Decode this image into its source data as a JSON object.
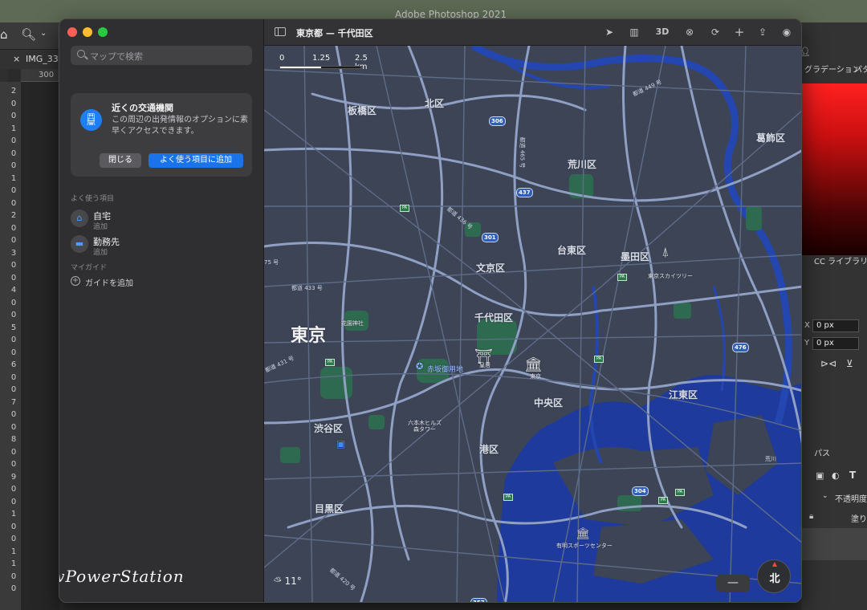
{
  "photoshop": {
    "title": "Adobe Photoshop 2021",
    "doc_tab": "IMG_33",
    "ruler_start": "300",
    "ruler_left_digits": [
      "2",
      "0",
      "0",
      "1",
      "0",
      "0",
      "0",
      "1",
      "0",
      "0",
      "2",
      "0",
      "0",
      "3",
      "0",
      "0",
      "4",
      "0",
      "0",
      "5",
      "0",
      "0",
      "6",
      "0",
      "0",
      "7",
      "0",
      "0",
      "8",
      "0",
      "0",
      "9",
      "0",
      "0",
      "1",
      "0",
      "0",
      "1",
      "1",
      "0",
      "0"
    ],
    "right_panel": {
      "gradients_tab": "グラデーション",
      "patterns_tab": "パタ",
      "libraries_label": "CC ライブラリ",
      "x_label": "X",
      "x_value": "0 px",
      "y_label": "Y",
      "y_value": "0 px",
      "paths_tab": "パス",
      "opacity_label": "不透明度",
      "fill_label": "塗り"
    }
  },
  "maps": {
    "search_placeholder": "マップで検索",
    "transit_card": {
      "title": "近くの交通機関",
      "body": "この周辺の出発情報のオプションに素早くアクセスできます。",
      "close_label": "閉じる",
      "add_label": "よく使う項目に追加"
    },
    "favorites_header": "よく使う項目",
    "favorites": [
      {
        "name": "自宅",
        "sub": "追加"
      },
      {
        "name": "勤務先",
        "sub": "追加"
      }
    ],
    "guides_header": "マイガイド",
    "add_guide_label": "ガイドを追加",
    "watermark": "LowPowerStation",
    "map_title": "東京都 — 千代田区",
    "toolbar_3d": "3D",
    "scale": {
      "s0": "0",
      "s1": "1.25",
      "s2": "2.5 km"
    },
    "weather": "11°",
    "compass": "北",
    "zoom_out": "—",
    "wards": {
      "kita": "北区",
      "itabashi": "板橋区",
      "arakawa": "荒川区",
      "katsushika": "葛飾区",
      "taito": "台東区",
      "bunkyo": "文京区",
      "sumida": "墨田区",
      "chiyoda": "千代田区",
      "tokyo": "東京",
      "koto": "江東区",
      "chuo": "中央区",
      "shibuya": "渋谷区",
      "minato": "港区",
      "meguro": "目黒区"
    },
    "pois": {
      "skytree": "東京スカイツリー",
      "hanazono": "花園神社",
      "akasaka": "赤坂御用地",
      "imperial": "皇居",
      "tokyo_station": "東京",
      "roppongi_line1": "六本木ヒルズ",
      "roppongi_line2": "森タワー",
      "ariake": "有明スポーツセンター"
    },
    "route_shields": [
      "306",
      "437",
      "301",
      "476",
      "304",
      "357"
    ],
    "highway_labels": {
      "h1": "都道 449 号",
      "h2": "都道 436 号",
      "h3": "都道 433 号",
      "h4": "都道 431 号",
      "h5": "都道 420 号",
      "h6": "都道 465 号",
      "h7": "75 号",
      "h8": "荒川"
    }
  }
}
